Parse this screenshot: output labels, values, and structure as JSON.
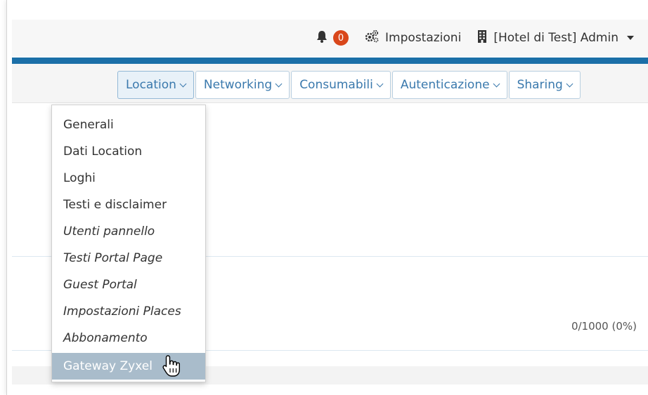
{
  "header": {
    "notifications_count": "0",
    "settings_label": "Impostazioni",
    "user_label": "[Hotel di Test] Admin"
  },
  "nav": {
    "tabs": [
      {
        "label": "Location"
      },
      {
        "label": "Networking"
      },
      {
        "label": "Consumabili"
      },
      {
        "label": "Autenticazione"
      },
      {
        "label": "Sharing"
      }
    ]
  },
  "dropdown": {
    "items": [
      {
        "label": "Generali"
      },
      {
        "label": "Dati Location"
      },
      {
        "label": "Loghi"
      },
      {
        "label": "Testi e disclaimer"
      },
      {
        "label": "Utenti pannello"
      },
      {
        "label": "Testi Portal Page"
      },
      {
        "label": "Guest Portal"
      },
      {
        "label": "Impostazioni Places"
      },
      {
        "label": "Abbonamento"
      },
      {
        "label": "Gateway Zyxel"
      }
    ]
  },
  "content": {
    "counter": "0/1000 (0%)"
  },
  "colors": {
    "accent_bar": "#1b6fa8",
    "badge": "#d9471b",
    "link": "#3a79ad",
    "hover_item": "#a9bccb"
  }
}
